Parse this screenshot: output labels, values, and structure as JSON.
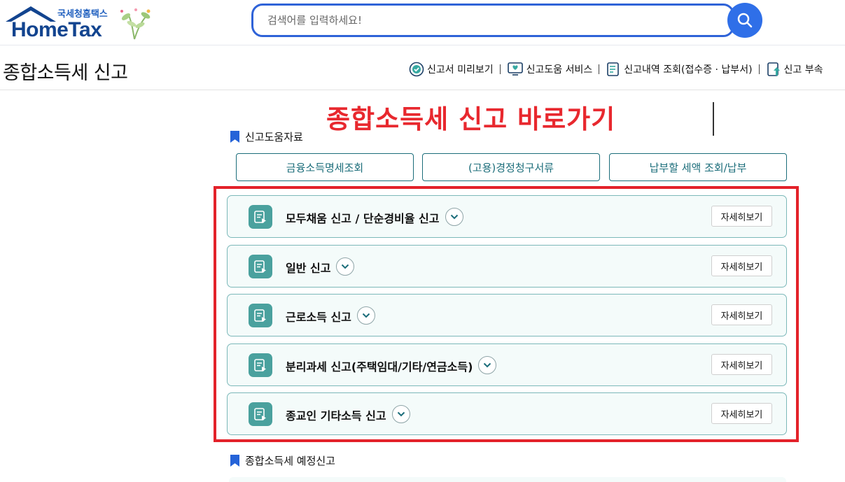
{
  "header": {
    "logo_sub": "국세청홈택스",
    "logo_main": "HomeTax",
    "search_placeholder": "검색어를 입력하세요!"
  },
  "page": {
    "title": "종합소득세 신고",
    "quick_links": [
      {
        "label": "신고서 미리보기",
        "icon": "preview-icon"
      },
      {
        "label": "신고도움 서비스",
        "icon": "monitor-heart-icon"
      },
      {
        "label": "신고내역 조회(접수증 · 납부서)",
        "icon": "document-list-icon"
      },
      {
        "label": "신고 부속",
        "icon": "upload-doc-icon"
      }
    ]
  },
  "banner": {
    "text": "종합소득세 신고 바로가기",
    "color": "#e8282e"
  },
  "help_section": {
    "title": "신고도움자료",
    "buttons": [
      "금융소득명세조회",
      "(고용)경정청구서류",
      "납부할 세액 조회/납부"
    ]
  },
  "filing_cards": [
    {
      "title": "모두채움 신고 / 단순경비율 신고",
      "detail": "자세히보기"
    },
    {
      "title": "일반 신고",
      "detail": "자세히보기"
    },
    {
      "title": "근로소득 신고",
      "detail": "자세히보기"
    },
    {
      "title": "분리과세 신고(주택임대/기타/연금소득)",
      "detail": "자세히보기"
    },
    {
      "title": "종교인 기타소득 신고",
      "detail": "자세히보기"
    }
  ],
  "estimate_section": {
    "title": "종합소득세 예정신고"
  },
  "colors": {
    "accent_blue": "#2f63d8",
    "teal": "#1b6d7a",
    "card_bg": "#f4fbfa",
    "highlight_red": "#e3222a"
  }
}
